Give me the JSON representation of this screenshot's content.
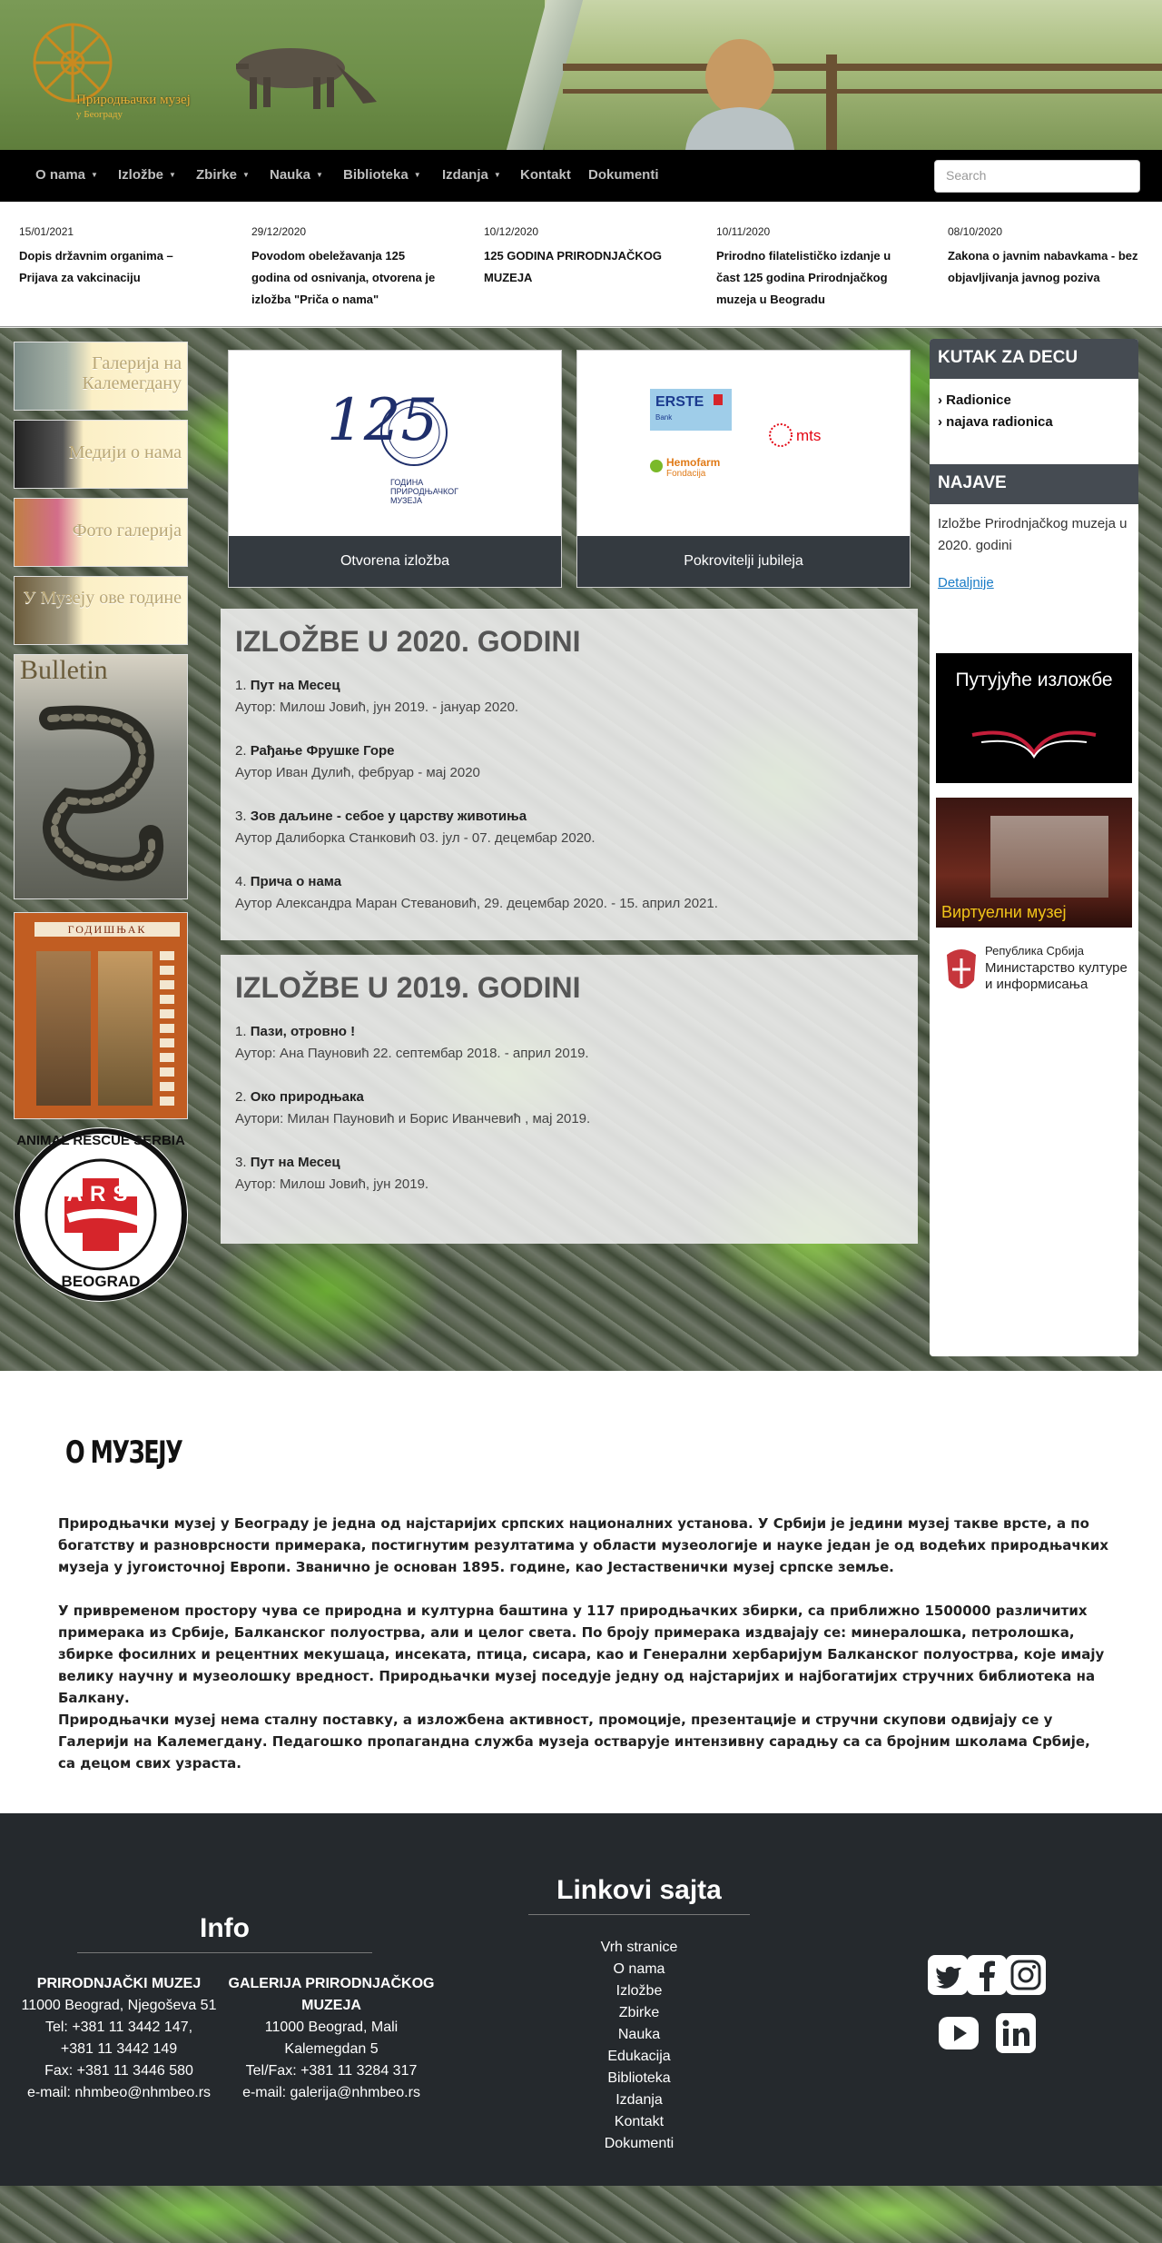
{
  "header": {
    "logo_line1": "Природњачки музеј",
    "logo_line2": "у Београду"
  },
  "nav": {
    "items": [
      {
        "label": "O nama",
        "dropdown": true
      },
      {
        "label": "Izložbe",
        "dropdown": true
      },
      {
        "label": "Zbirke",
        "dropdown": true
      },
      {
        "label": "Nauka",
        "dropdown": true
      },
      {
        "label": "Biblioteka",
        "dropdown": true
      },
      {
        "label": "Izdanja",
        "dropdown": true
      },
      {
        "label": "Kontakt",
        "dropdown": false
      },
      {
        "label": "Dokumenti",
        "dropdown": false
      }
    ],
    "search_placeholder": "Search"
  },
  "news": [
    {
      "date": "15/01/2021",
      "title": "Dopis državnim organima – Prijava za vakcinaciju"
    },
    {
      "date": "29/12/2020",
      "title": "Povodom obeležavanja 125 godina od osnivanja, otvorena je izložba \"Priča o nama\""
    },
    {
      "date": "10/12/2020",
      "title": "125 GODINA PRIRODNJAČKOG MUZEJA"
    },
    {
      "date": "10/11/2020",
      "title": "Prirodno filatelističko izdanje u čast 125 godina Prirodnjačkog muzeja u Beogradu"
    },
    {
      "date": "08/10/2020",
      "title": "Zakona o javnim nabavkama - bez objavljivanja javnog poziva"
    }
  ],
  "left_banners": {
    "galerija": "Галерија на Калемегдану",
    "mediji": "Медији о нама",
    "foto": "Фото галерија",
    "u_muzeju": "У Музеју ове године",
    "bulletin": "Bulletin",
    "godisnjak": "ГОДИШЊАК",
    "ars_top": "ANIMAL RESCUE SERBIA",
    "ars_mid": "ARS",
    "ars_bottom": "BEOGRAD"
  },
  "cards": [
    {
      "footer": "Otvorena izložba",
      "logo_125": "125",
      "logo_caption": "ГОДИНА ПРИРОДЊАЧКОГ МУЗЕЈА"
    },
    {
      "footer": "Pokrovitelji jubileja",
      "sponsor1": "ERSTE",
      "sponsor1_sub": "Bank",
      "sponsor2": "mts",
      "sponsor3": "Hemofarm",
      "sponsor3_sub": "Fondacija"
    }
  ],
  "expo2020": {
    "title": "IZLOŽBE U 2020. GODINI",
    "items": [
      {
        "num": "1.",
        "name": "Пут на Месец",
        "meta": "Аутор: Милош Јовић, јун 2019. - јануар 2020."
      },
      {
        "num": "2.",
        "name": "Рађање Фрушке Горе",
        "meta": "Аутор Иван Дулић, фебруар - мај 2020"
      },
      {
        "num": "3.",
        "name": "Зов даљине - себое у царству животиња",
        "meta": "Аутор Далиборка Станковић 03. јул - 07. децембар 2020."
      },
      {
        "num": "4.",
        "name": "Прича о нама",
        "meta": "Аутор Александра Маран Стевановић, 29. децембар 2020. - 15. април 2021."
      }
    ]
  },
  "expo2019": {
    "title": "IZLOŽBE U 2019. GODINI",
    "items": [
      {
        "num": "1.",
        "name": "Пази, отровно !",
        "meta": "Аутор: Ана Пауновић 22. септембар 2018. - април 2019."
      },
      {
        "num": "2.",
        "name": "Око природњака",
        "meta": "Аутори: Милан Пауновић и Борис Иванчевић , мај 2019."
      },
      {
        "num": "3.",
        "name": "Пут на Месец",
        "meta": "Аутор: Милош Јовић, јун 2019."
      }
    ]
  },
  "sidebar": {
    "kutak_title": "KUTAK ZA DECU",
    "kutak_links": [
      "Radionice",
      "najava radionica"
    ],
    "najave_title": "NAJAVE",
    "najave_text": "Izložbe Prirodnjačkog muzeja u 2020. godini",
    "najave_more": "Detaljnije",
    "putujuce": "Путујуће изложбе",
    "virtuelni": "Виртуелни музеј",
    "ministry_line1": "Република Србија",
    "ministry_line2": "Министарство културе",
    "ministry_line3": "и информисања"
  },
  "about": {
    "title": "О МУЗЕЈУ",
    "p1": "Природњачки музеј у Београду је једна од најстаријих српских националних установа. У Србији је једини музеј такве врсте, а по богатству и разноврсности примерака, постигнутим резултатима у области музеологије и науке један је од водећих природњачких музеја у југоисточној Европи. Званично је основан 1895. године, као Јестаственички музеј српске земље.",
    "p2": "У привременом простору чува се природна и културна баштина у 117 природњачких збирки, са приближно 1500000 различитих примерака из Србије, Балканског полуострва, али и целог света. По броју примерака издвајају се: минералошка, петролошка, збирке фосилних и рецентних мекушаца, инсеката, птица, сисара, као и Генерални хербаријум Балканског полуострва, које имају велику научну и музеолошку вредност. Природњачки музеј поседује једну од најстаријих и најбогатијих стручних библиотека на Балкану.",
    "p3": "Природњачки музеј нема сталну поставку, а изложбена активност, промоције, презентације и стручни скупови одвијају се у Галерији на Калемегдану. Педагошко пропагандна служба музеја остварује интензивну сарадњу са са бројним школама Србије, са децом свих узраста."
  },
  "footer": {
    "info_title": "Info",
    "col1": [
      "PRIRODNJAČKI MUZEJ",
      "11000 Beograd, Njegoševa 51",
      "Tel: +381 11 3442 147,",
      "+381 11 3442 149",
      "Fax: +381 11 3446 580",
      "e-mail: nhmbeo@nhmbeo.rs"
    ],
    "col2": [
      "GALERIJA PRIRODNJAČKOG",
      "MUZEJA",
      "11000 Beograd, Mali",
      "Kalemegdan 5",
      "Tel/Fax: +381 11 3284 317",
      "e-mail: galerija@nhmbeo.rs"
    ],
    "links_title": "Linkovi sajta",
    "links": [
      "Vrh stranice",
      "O nama",
      "Izložbe",
      "Zbirke",
      "Nauka",
      "Edukacija",
      "Biblioteka",
      "Izdanja",
      "Kontakt",
      "Dokumenti"
    ],
    "social": [
      "twitter-icon",
      "facebook-icon",
      "instagram-icon",
      "youtube-icon",
      "linkedin-icon"
    ]
  }
}
